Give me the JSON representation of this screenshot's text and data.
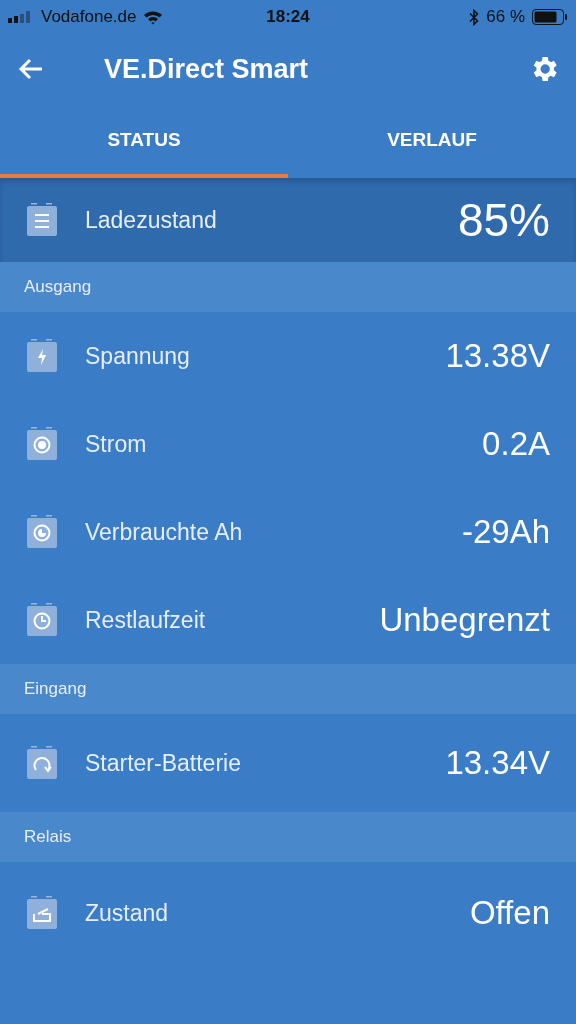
{
  "status_bar": {
    "carrier": "Vodafone.de",
    "time": "18:24",
    "battery": "66 %"
  },
  "app_bar": {
    "title": "VE.Direct Smart"
  },
  "tabs": [
    {
      "label": "STATUS",
      "selected": true
    },
    {
      "label": "VERLAUF",
      "selected": false
    }
  ],
  "summary": {
    "label": "Ladezustand",
    "value": "85%"
  },
  "sections": [
    {
      "title": "Ausgang",
      "rows": [
        {
          "label": "Spannung",
          "value": "13.38V"
        },
        {
          "label": "Strom",
          "value": "0.2A"
        },
        {
          "label": "Verbrauchte Ah",
          "value": "-29Ah"
        },
        {
          "label": "Restlaufzeit",
          "value": "Unbegrenzt"
        }
      ]
    },
    {
      "title": "Eingang",
      "rows": [
        {
          "label": "Starter-Batterie",
          "value": "13.34V"
        }
      ]
    },
    {
      "title": "Relais",
      "rows": [
        {
          "label": "Zustand",
          "value": "Offen"
        }
      ]
    }
  ]
}
